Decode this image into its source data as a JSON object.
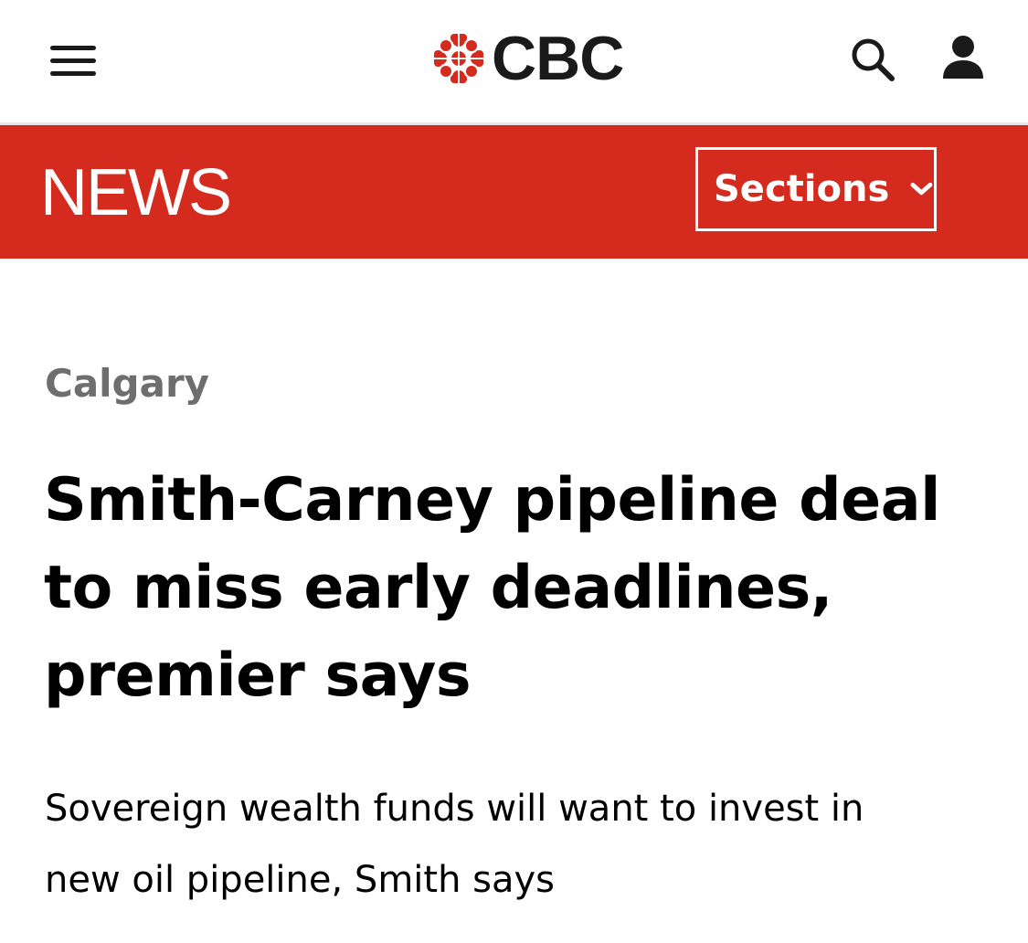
{
  "header": {
    "logo_text": "CBC",
    "icons": {
      "menu": "hamburger-menu-icon",
      "logo": "cbc-gem-icon",
      "search": "search-icon",
      "account": "user-account-icon"
    }
  },
  "news_bar": {
    "title": "NEWS",
    "sections_label": "Sections",
    "sections_icon": "chevron-down-icon",
    "background_color": "#d52b1e"
  },
  "article": {
    "kicker": "Calgary",
    "headline_lines": [
      "Smith-Carney pipeline deal",
      "to miss early deadlines,",
      "premier says"
    ],
    "deck_lines": [
      "Sovereign wealth funds will want to invest in",
      "new oil pipeline, Smith says"
    ]
  },
  "colors": {
    "brand_red": "#d52b1e",
    "kicker_gray": "#6e6e6e",
    "text": "#000000"
  }
}
